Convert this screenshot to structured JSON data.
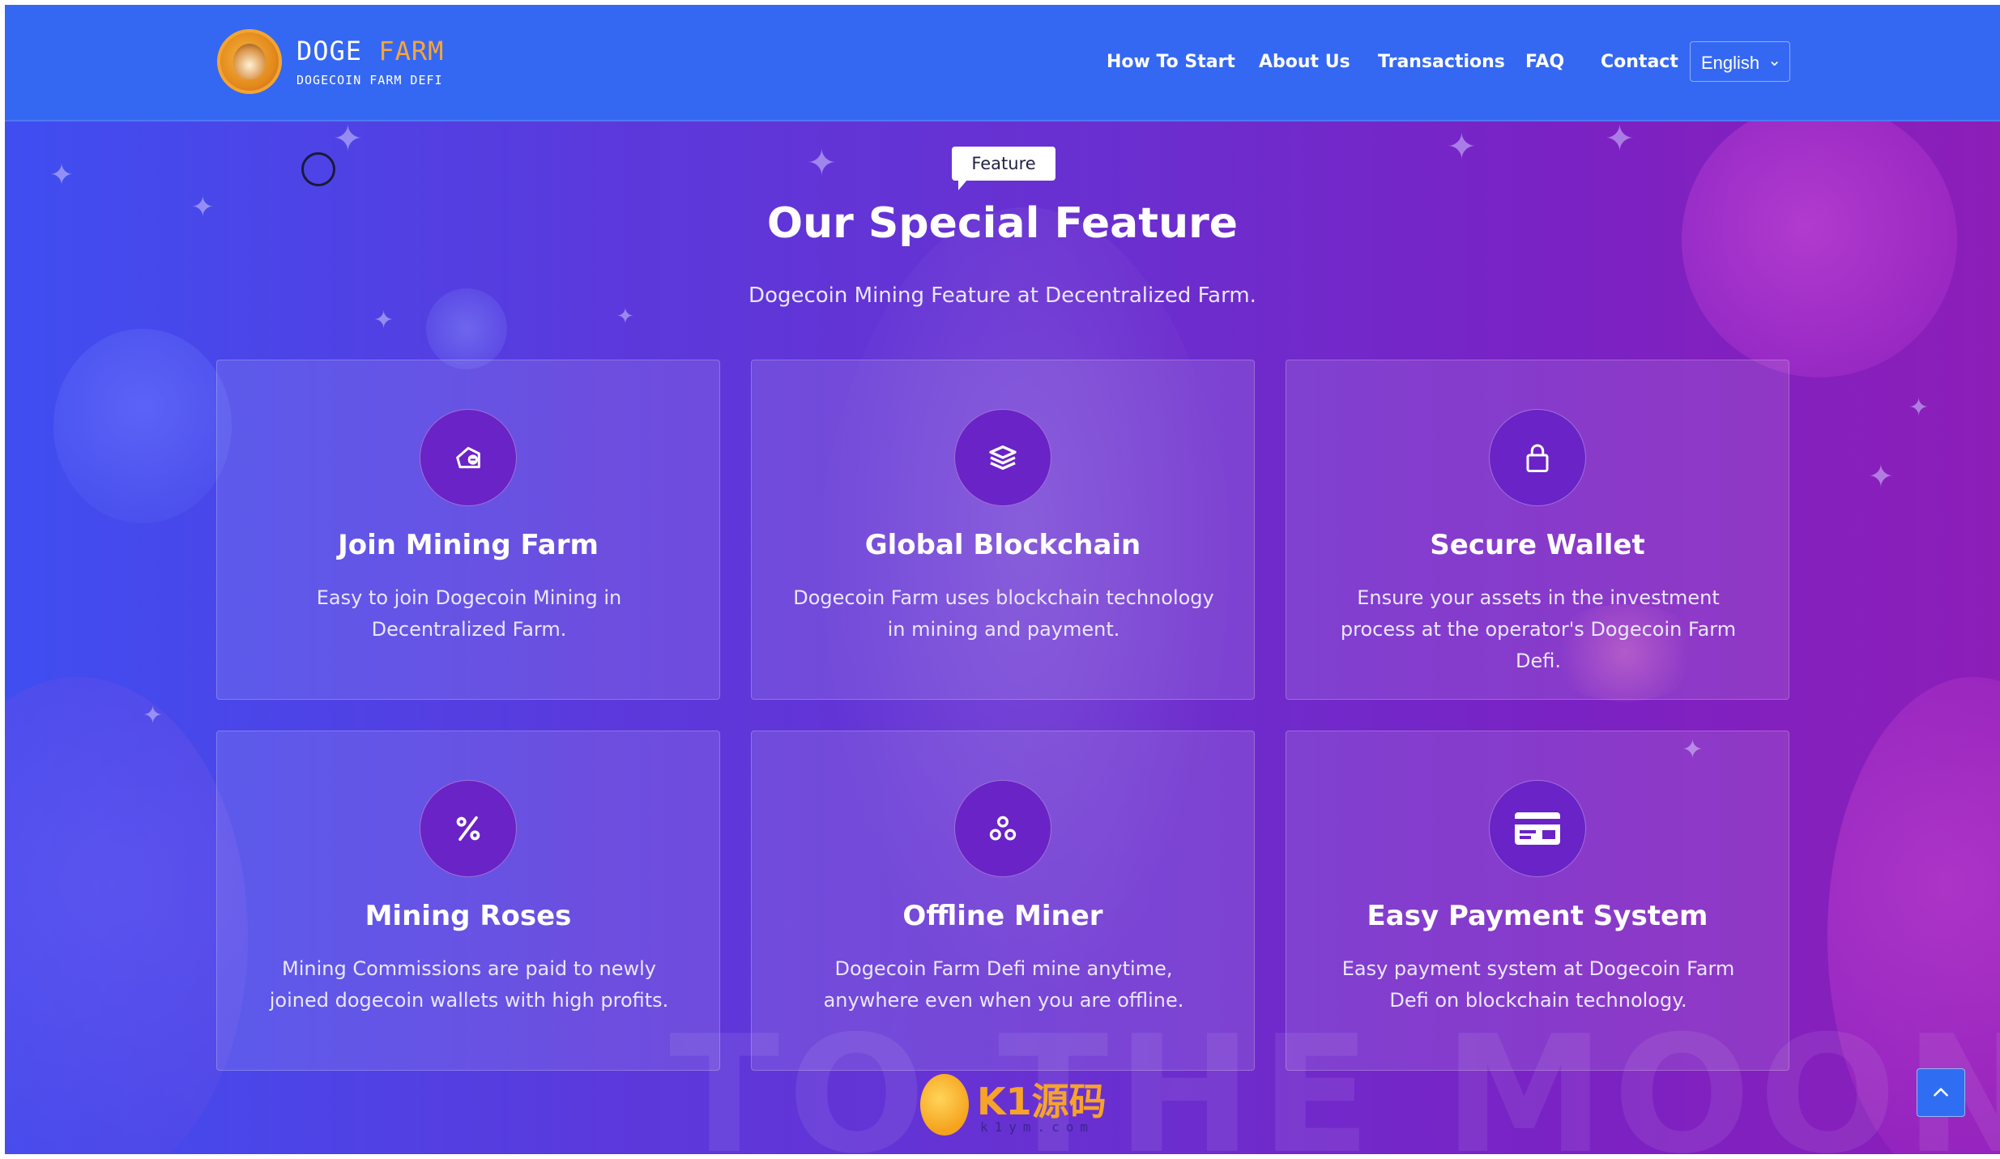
{
  "header": {
    "brand_main": "DOGE",
    "brand_accent": "FARM",
    "brand_tagline": "DOGECOIN FARM DEFI",
    "nav": [
      {
        "label": "How To Start"
      },
      {
        "label": "About Us"
      },
      {
        "label": "Transactions"
      },
      {
        "label": "FAQ"
      },
      {
        "label": "Contact"
      }
    ],
    "language": {
      "selected": "English"
    }
  },
  "hero": {
    "badge": "Feature",
    "title": "Our Special Feature",
    "subtitle": "Dogecoin Mining Feature at Decentralized Farm."
  },
  "features": [
    {
      "icon": "hand-coin-icon",
      "title": "Join Mining Farm",
      "description": "Easy to join Dogecoin Mining in Decentralized Farm."
    },
    {
      "icon": "layers-icon",
      "title": "Global Blockchain",
      "description": "Dogecoin Farm uses blockchain technology in mining and payment."
    },
    {
      "icon": "lock-icon",
      "title": "Secure Wallet",
      "description": "Ensure your assets in the investment process at the operator's Dogecoin Farm Defi."
    },
    {
      "icon": "percent-icon",
      "title": "Mining Roses",
      "description": "Mining Commissions are paid to newly joined dogecoin wallets with high profits."
    },
    {
      "icon": "nodes-icon",
      "title": "Offline Miner",
      "description": "Dogecoin Farm Defi mine anytime, anywhere even when you are offline."
    },
    {
      "icon": "credit-card-icon",
      "title": "Easy Payment System",
      "description": "Easy payment system at Dogecoin Farm Defi on blockchain technology."
    }
  ],
  "background_text": "TO THE MOON",
  "watermark": {
    "text": "K1源码",
    "sub": "k1ym.com"
  },
  "colors": {
    "header_bg": "#3568f2",
    "accent_orange": "#f7a53a",
    "icon_circle": "#6a23c6"
  }
}
